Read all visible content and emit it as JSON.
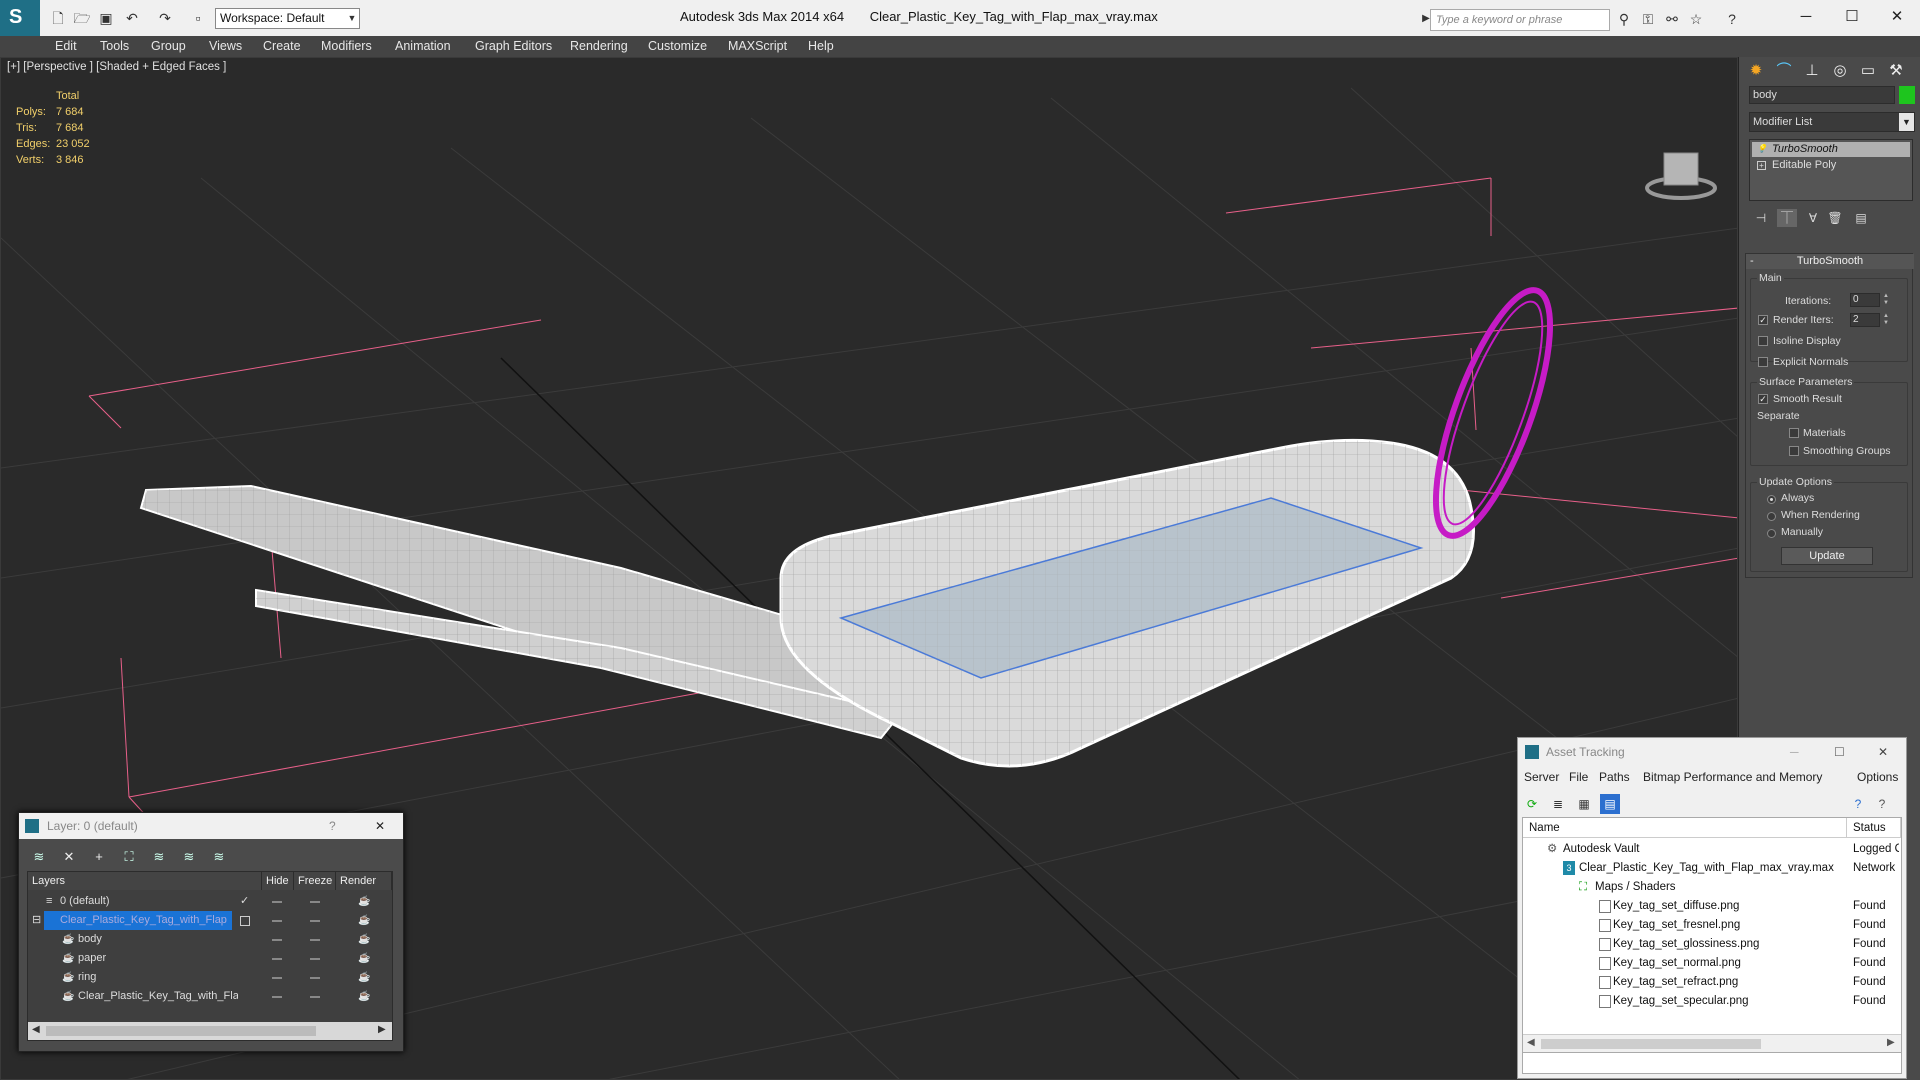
{
  "window": {
    "app_title": "Autodesk 3ds Max  2014 x64",
    "file_title": "Clear_Plastic_Key_Tag_with_Flap_max_vray.max",
    "workspace": "Workspace: Default",
    "search_placeholder": "Type a keyword or phrase",
    "min": "─",
    "max": "☐",
    "close": "✕"
  },
  "menu": [
    "Edit",
    "Tools",
    "Group",
    "Views",
    "Create",
    "Modifiers",
    "Animation",
    "Graph Editors",
    "Rendering",
    "Customize",
    "MAXScript",
    "Help"
  ],
  "viewport": {
    "label": "[+] [Perspective ] [Shaded + Edged Faces ]",
    "stats_header": "Total",
    "stats": [
      {
        "label": "Polys:",
        "value": "7 684"
      },
      {
        "label": "Tris:",
        "value": "7 684"
      },
      {
        "label": "Edges:",
        "value": "23 052"
      },
      {
        "label": "Verts:",
        "value": "3 846"
      }
    ]
  },
  "command_panel": {
    "object_name": "body",
    "object_color": "#1ec51e",
    "modifier_list": "Modifier List",
    "stack": [
      "TurboSmooth",
      "Editable Poly"
    ],
    "rollout_title": "TurboSmooth",
    "main_group": "Main",
    "iterations_label": "Iterations:",
    "iterations_value": "0",
    "render_iters_label": "Render Iters:",
    "render_iters_value": "2",
    "isoline": "Isoline Display",
    "explicit_normals": "Explicit Normals",
    "surface_group": "Surface Parameters",
    "smooth_result": "Smooth Result",
    "separate": "Separate",
    "materials": "Materials",
    "smoothing_groups": "Smoothing Groups",
    "update_group": "Update Options",
    "always": "Always",
    "when_rendering": "When Rendering",
    "manually": "Manually",
    "update_button": "Update"
  },
  "layer_dialog": {
    "title": "Layer: 0 (default)",
    "help": "?",
    "close": "✕",
    "headers": [
      "Layers",
      "Hide",
      "Freeze",
      "Render"
    ],
    "rows": [
      "0 (default)",
      "Clear_Plastic_Key_Tag_with_Flap",
      "body",
      "paper",
      "ring",
      "Clear_Plastic_Key_Tag_with_Flap"
    ]
  },
  "asset_dialog": {
    "title": "Asset Tracking",
    "menu": [
      "Server",
      "File",
      "Paths",
      "Bitmap Performance and Memory",
      "Options"
    ],
    "headers": [
      "Name",
      "Status"
    ],
    "rows": [
      {
        "name": "Autodesk Vault",
        "status": "Logged Ou"
      },
      {
        "name": "Clear_Plastic_Key_Tag_with_Flap_max_vray.max",
        "status": "Network P"
      },
      {
        "name": "Maps / Shaders",
        "status": ""
      },
      {
        "name": "Key_tag_set_diffuse.png",
        "status": "Found"
      },
      {
        "name": "Key_tag_set_fresnel.png",
        "status": "Found"
      },
      {
        "name": "Key_tag_set_glossiness.png",
        "status": "Found"
      },
      {
        "name": "Key_tag_set_normal.png",
        "status": "Found"
      },
      {
        "name": "Key_tag_set_refract.png",
        "status": "Found"
      },
      {
        "name": "Key_tag_set_specular.png",
        "status": "Found"
      }
    ]
  }
}
